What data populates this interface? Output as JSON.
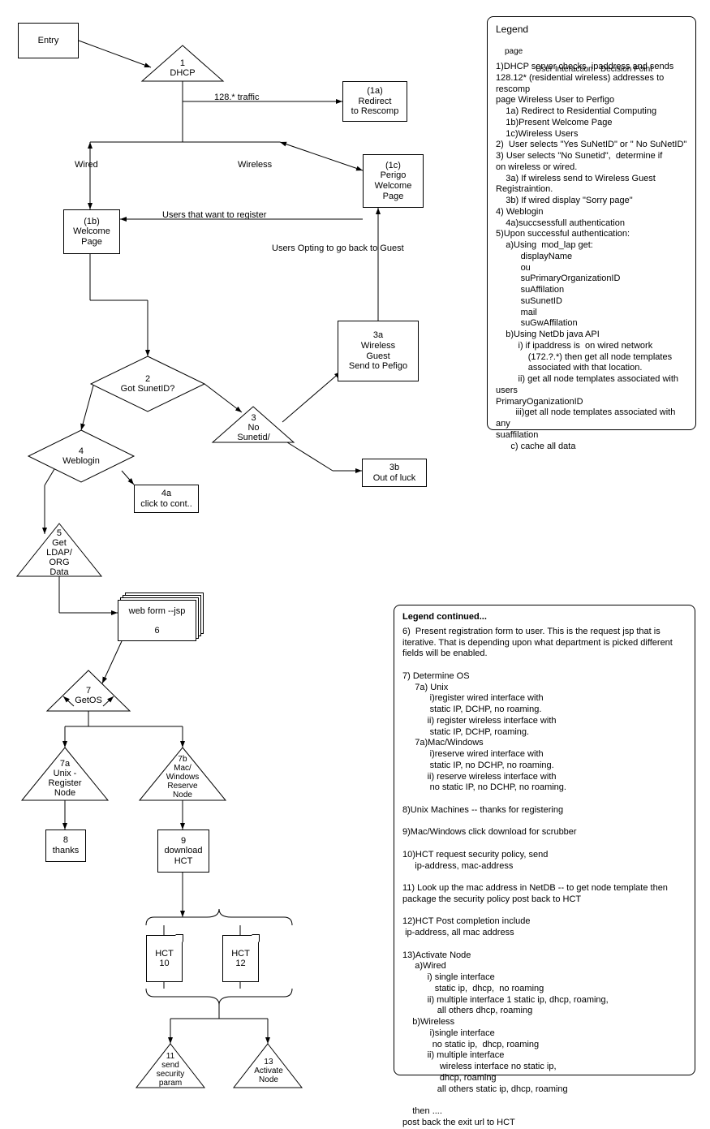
{
  "nodes": {
    "entry": "Entry",
    "dhcp": "1\nDHCP",
    "redirect_rescomp": "(1a)\nRedirect\nto Rescomp",
    "perigo_welcome": "(1c)\nPerigo\nWelcome\nPage",
    "welcome_page": "(1b)\nWelcome\nPage",
    "got_sunetid": "2\nGot SunetID?",
    "no_sunetid": "3\nNo\nSunetid/",
    "wireless_guest": "3a\nWireless\nGuest\nSend to Pefigo",
    "out_of_luck": "3b\nOut of luck",
    "weblogin": "4\nWeblogin",
    "click_to_cont": "4a\nclick to cont..",
    "get_ldap": "5\nGet\nLDAP/\nORG\nData",
    "web_form": "web form --jsp\n\n6",
    "getos": "7\nGetOS",
    "unix_register": "7a\nUnix -\nRegister\nNode",
    "mac_reserve": "7b\nMac/\nWindows\nReserve\nNode",
    "thanks": "8\nthanks",
    "download_hct": "9\ndownload\nHCT",
    "hct10": "HCT\n10",
    "hct12": "HCT\n12",
    "send_security": "11\nsend\nsecurity\nparam",
    "activate_node": "13\nActivate\nNode"
  },
  "edgeLabels": {
    "128traffic": "128.* traffic",
    "wired": "Wired",
    "wireless": "Wireless",
    "users_register": "Users that want to register",
    "users_opting": "Users Opting to go back to Guest"
  },
  "legendBox": {
    "title": "Legend",
    "page": "page",
    "user_interaction": "User Interaction",
    "decision_point": "Decision Point",
    "body": "1)DHCP server checks  ipaddress and sends\n128.12* (residential wireless) addresses to rescomp\npage Wireless User to Perfigo\n    1a) Redirect to Residential Computing\n    1b)Present Welcome Page\n    1c)Wireless Users\n2)  User selects \"Yes SuNetID\" or \" No SuNetID\"\n3) User selects \"No Sunetid\",  determine if\non wireless or wired.\n    3a) If wireless send to Wireless Guest\nRegistraintion.\n    3b) If wired display \"Sorry page\"\n4) Weblogin\n    4a)succsessfull authentication\n5)Upon successful authentication:\n    a)Using  mod_lap get:\n          displayName\n          ou\n          suPrimaryOrganizationID\n          suAffilation\n          suSunetID\n          mail\n          suGwAffilation\n    b)Using NetDb java API\n         i) if ipaddress is  on wired network\n             (172.?.*) then get all node templates\n             associated with that location.\n         ii) get all node templates associated with users\nPrimaryOganizationID\n        iii)get all node templates associated with any\nsuaffilation\n      c) cache all data"
  },
  "legend2": {
    "title": "Legend continued...",
    "body": "6)  Present registration form to user. This is the request jsp that is\niterative. That is depending upon what department is picked different\nfields will be enabled.\n\n7) Determine OS\n     7a) Unix\n           i)register wired interface with\n           static IP, DCHP, no roaming.\n          ii) register wireless interface with\n           static IP, DCHP, roaming.\n     7a)Mac/Windows\n           i)reserve wired interface with\n           static IP, no DCHP, no roaming.\n          ii) reserve wireless interface with\n           no static IP, no DCHP, no roaming.\n\n8)Unix Machines -- thanks for registering\n\n9)Mac/Windows click download for scrubber\n\n10)HCT request security policy, send\n     ip-address, mac-address\n\n11) Look up the mac address in NetDB -- to get node template then\npackage the security policy post back to HCT\n\n12)HCT Post completion include\n ip-address, all mac address\n\n13)Activate Node\n     a)Wired\n          i) single interface\n             static ip,  dhcp,  no roaming\n          ii) multiple interface 1 static ip, dhcp, roaming,\n              all others dhcp, roaming\n    b)Wireless\n           i)single interface\n            no static ip,  dhcp, roaming\n          ii) multiple interface\n               wireless interface no static ip,\n               dhcp, roaming\n              all others static ip, dhcp, roaming\n\n    then ....\npost back the exit url to HCT"
  }
}
